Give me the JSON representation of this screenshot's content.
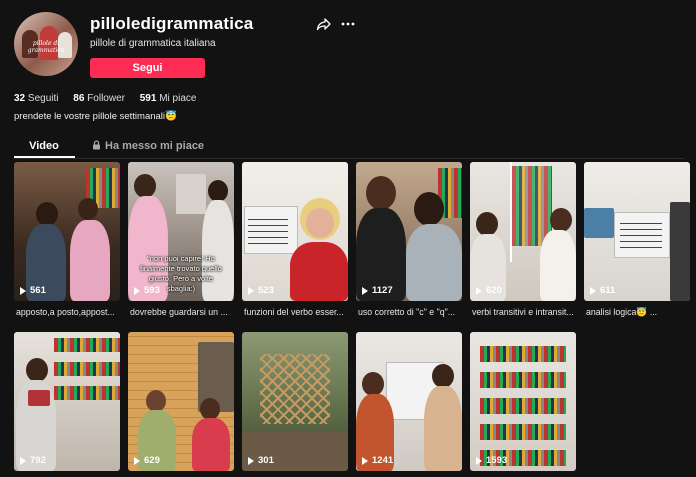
{
  "profile": {
    "username": "pilloledigrammatica",
    "display_name": "pillole di grammatica italiana",
    "avatar_text": "pillole di grammatica",
    "follow_label": "Segui",
    "following_count": "32",
    "following_label": "Seguiti",
    "followers_count": "86",
    "followers_label": "Follower",
    "likes_count": "591",
    "likes_label": "Mi piace",
    "bio": "prendete le vostre pillole settimanali😇"
  },
  "tabs": {
    "videos": "Video",
    "liked": "Ha messo mi piace"
  },
  "videos": [
    {
      "views": "561",
      "caption": "apposto,a posto,appost..."
    },
    {
      "views": "593",
      "caption": "dovrebbe guardarsi un ...",
      "overlay": "\"non puoi capire! Ho finalmente trovato quello giusto. Però a volte sbaglia:)"
    },
    {
      "views": "523",
      "caption": "funzioni del verbo esser..."
    },
    {
      "views": "1127",
      "caption": "uso corretto di \"c\" e \"q\"..."
    },
    {
      "views": "620",
      "caption": "verbi transitivi e intransit..."
    },
    {
      "views": "611",
      "caption": "analisi logica😇 ..."
    },
    {
      "views": "792",
      "caption": ""
    },
    {
      "views": "629",
      "caption": ""
    },
    {
      "views": "301",
      "caption": ""
    },
    {
      "views": "1241",
      "caption": ""
    },
    {
      "views": "1593",
      "caption": ""
    }
  ],
  "colors": {
    "background": "#121212",
    "accent": "#fe2c55"
  }
}
